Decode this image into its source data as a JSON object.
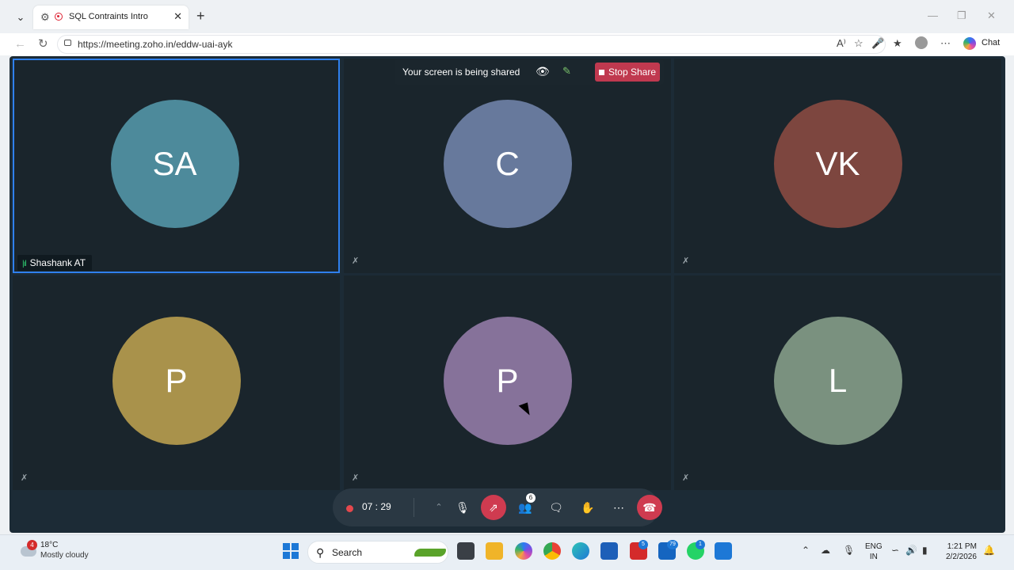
{
  "browser": {
    "tab_title": "SQL Contraints Intro",
    "url": "https://meeting.zoho.in/eddw-uai-ayk",
    "chat_label": "Chat"
  },
  "meeting": {
    "share_banner": {
      "text": "Your screen is being shared",
      "stop_label": "Stop Share"
    },
    "participants": [
      {
        "initials": "SA",
        "name": "Shashank AT",
        "color": "#4d8a9b",
        "active": true
      },
      {
        "initials": "C",
        "color": "#67799c"
      },
      {
        "initials": "VK",
        "color": "#7d463f"
      },
      {
        "initials": "P",
        "color": "#a9924b"
      },
      {
        "initials": "P",
        "color": "#86729a"
      },
      {
        "initials": "L",
        "color": "#7a917f"
      }
    ],
    "controls": {
      "timer": "07 : 29",
      "participant_count": "6"
    }
  },
  "taskbar": {
    "weather_badge": "4",
    "temperature": "18°C",
    "condition": "Mostly cloudy",
    "search_label": "Search",
    "app_badges": {
      "l_app": "5",
      "mail": "79",
      "whatsapp": "1"
    },
    "language": "ENG",
    "region": "IN",
    "time": "1:21 PM",
    "date": "2/2/2026"
  },
  "icons": [
    "settings-icon",
    "record-icon",
    "mic-muted-icon",
    "eye-icon",
    "pen-icon",
    "chevron-up-icon",
    "mic-icon",
    "share-screen-icon",
    "participants-icon",
    "chat-icon",
    "reactions-icon",
    "more-icon",
    "hang-up-icon",
    "windows-start-icon",
    "search-icon"
  ]
}
